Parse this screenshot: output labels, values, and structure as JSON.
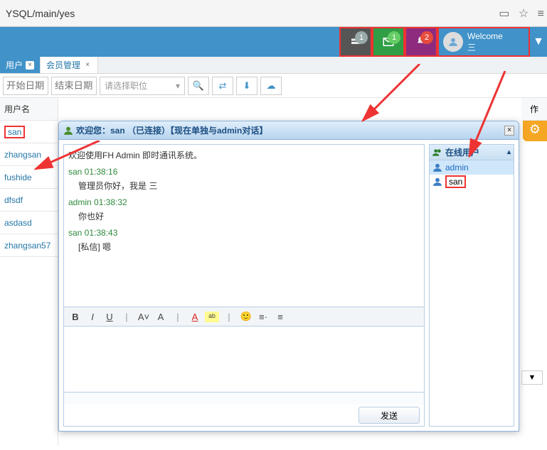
{
  "address": {
    "url": "YSQL/main/yes"
  },
  "topnav": {
    "inbox_badge": "1",
    "mail_badge": "1",
    "bell_badge": "2",
    "welcome_label": "Welcome",
    "welcome_sub": "三"
  },
  "tabs": {
    "a_label": "用户",
    "b_label": "会员管理"
  },
  "filters": {
    "start_placeholder": "开始日期",
    "end_placeholder": "结束日期",
    "select_placeholder": "请选择职位"
  },
  "usertable": {
    "header": "用户名",
    "rows": [
      "san",
      "zhangsan",
      "fushide",
      "dfsdf",
      "asdasd",
      "zhangsan57"
    ],
    "op_header": "作"
  },
  "dialog": {
    "title": "欢迎您：san （已连接）【现在单独与admin对话】",
    "sys_line": "欢迎使用FH Admin 即时通讯系统。",
    "messages": [
      {
        "meta": "san 01:38:16",
        "text": "管理员你好，我是 三"
      },
      {
        "meta": "admin 01:38:32",
        "text": "你也好"
      },
      {
        "meta": "san 01:38:43",
        "text": "[私信] 嗯"
      }
    ],
    "send_label": "发送"
  },
  "online": {
    "header": "在线用户",
    "users": [
      "admin",
      "san"
    ]
  },
  "pager": {
    "caret": "▼"
  }
}
